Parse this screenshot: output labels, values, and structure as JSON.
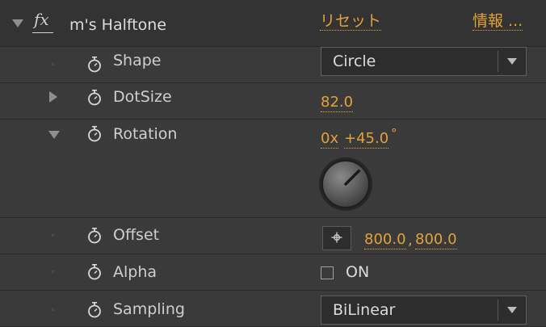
{
  "effect": {
    "title": "m's Halftone",
    "fx_symbol": "fx",
    "reset_label": "リセット",
    "about_label": "情報 ..."
  },
  "properties": {
    "shape": {
      "label": "Shape",
      "value": "Circle"
    },
    "dotsize": {
      "label": "DotSize",
      "value": "82.0"
    },
    "rotation": {
      "label": "Rotation",
      "revolutions": "0x",
      "degrees": "+45.0",
      "degree_symbol": "°",
      "angle_deg": 45
    },
    "offset": {
      "label": "Offset",
      "x": "800.0",
      "comma": ",",
      "y": "800.0"
    },
    "alpha": {
      "label": "Alpha",
      "checkbox_label": "ON",
      "checked": false
    },
    "sampling": {
      "label": "Sampling",
      "value": "BiLinear"
    }
  },
  "colors": {
    "accent": "#e2a23a",
    "panel_bg": "#3a3a3a",
    "header_bg": "#333333"
  }
}
